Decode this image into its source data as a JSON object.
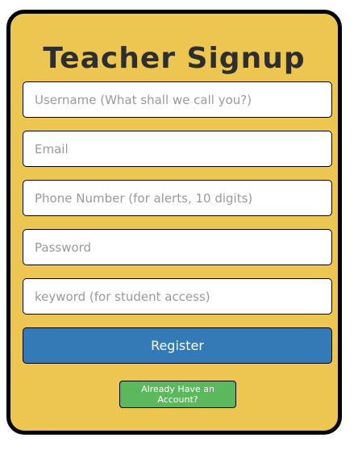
{
  "form": {
    "title": "Teacher Signup",
    "username_placeholder": "Username (What shall we call you?)",
    "email_placeholder": "Email",
    "phone_placeholder": "Phone Number (for alerts, 10 digits)",
    "password_placeholder": "Password",
    "keyword_placeholder": "keyword (for student access)",
    "register_label": "Register",
    "account_label": "Already Have an Account?"
  },
  "colors": {
    "card_background": "#edc651",
    "register_button": "#337ab7",
    "account_button": "#5cb85c"
  }
}
